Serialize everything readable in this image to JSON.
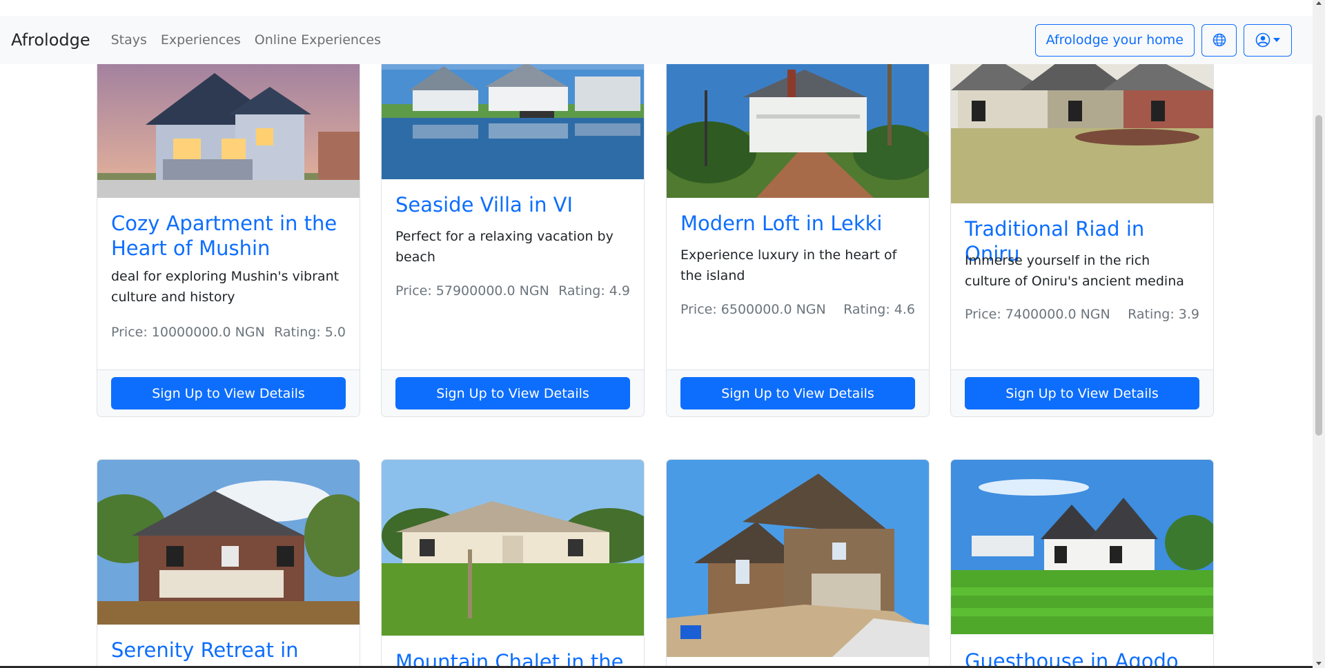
{
  "navbar": {
    "brand": "Afrolodge",
    "links": [
      "Stays",
      "Experiences",
      "Online Experiences"
    ],
    "host_button": "Afrolodge your home",
    "globe_icon": "globe-icon",
    "user_icon": "user-circle-icon"
  },
  "colors": {
    "accent": "#0d6efd",
    "navbar_bg": "#f8f9fa",
    "muted": "#6c757d"
  },
  "listings": [
    {
      "title": "Cozy Apartment in the Heart of Mushin",
      "description": "deal for exploring Mushin's vibrant culture and history",
      "price": "Price: 10000000.0 NGN",
      "rating": "Rating: 5.0",
      "button": "Sign Up to View Details"
    },
    {
      "title": "Seaside Villa in VI",
      "description": "Perfect for a relaxing vacation by beach",
      "price": "Price: 57900000.0 NGN",
      "rating": "Rating: 4.9",
      "button": "Sign Up to View Details"
    },
    {
      "title": "Modern Loft in Lekki",
      "description": "Experience luxury in the heart of the island",
      "price": "Price: 6500000.0 NGN",
      "rating": "Rating: 4.6",
      "button": "Sign Up to View Details"
    },
    {
      "title": "Traditional Riad in Oniru",
      "description": "Immerse yourself in the rich culture of Oniru's ancient medina",
      "price": "Price: 7400000.0 NGN",
      "rating": "Rating: 3.9",
      "button": "Sign Up to View Details"
    },
    {
      "title": "Serenity Retreat in Ikota"
    },
    {
      "title": "Mountain Chalet in the"
    },
    {
      "title": ""
    },
    {
      "title": "Guesthouse in Agodo"
    }
  ]
}
